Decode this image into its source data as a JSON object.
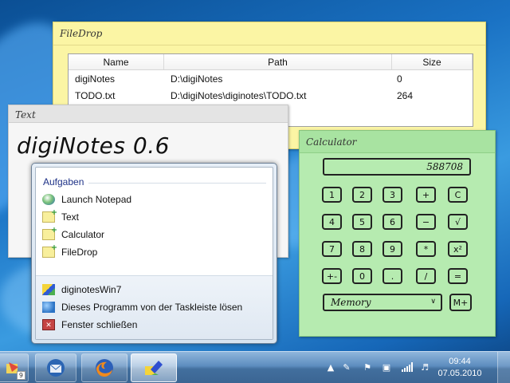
{
  "filedrop": {
    "title": "FileDrop",
    "columns": [
      "Name",
      "Path",
      "Size"
    ],
    "rows": [
      {
        "name": "digiNotes",
        "path": "D:\\digiNotes",
        "size": "0"
      },
      {
        "name": "TODO.txt",
        "path": "D:\\digiNotes\\diginotes\\TODO.txt",
        "size": "264"
      }
    ]
  },
  "text_note": {
    "title": "Text",
    "content": "digiNotes 0.6"
  },
  "calculator": {
    "title": "Calculator",
    "display": "588708",
    "keys": [
      "1",
      "2",
      "3",
      "+",
      "C",
      "4",
      "5",
      "6",
      "−",
      "√",
      "7",
      "8",
      "9",
      "*",
      "x²",
      "+-",
      "0",
      ".",
      "/",
      "="
    ],
    "memory_label": "Memory",
    "memory_button": "M+"
  },
  "jumplist": {
    "section_header": "Aufgaben",
    "tasks": [
      {
        "label": "Launch Notepad",
        "icon": "launch-notepad-icon"
      },
      {
        "label": "Text",
        "icon": "note-icon"
      },
      {
        "label": "Calculator",
        "icon": "note-icon"
      },
      {
        "label": "FileDrop",
        "icon": "note-icon"
      }
    ],
    "actions": [
      {
        "label": "diginotesWin7",
        "icon": "app-icon"
      },
      {
        "label": "Dieses Programm von der Taskleiste lösen",
        "icon": "unpin-icon"
      },
      {
        "label": "Fenster schließen",
        "icon": "close-window-icon"
      }
    ]
  },
  "taskbar": {
    "badge": "9",
    "time": "09:44",
    "date": "07.05.2010"
  }
}
